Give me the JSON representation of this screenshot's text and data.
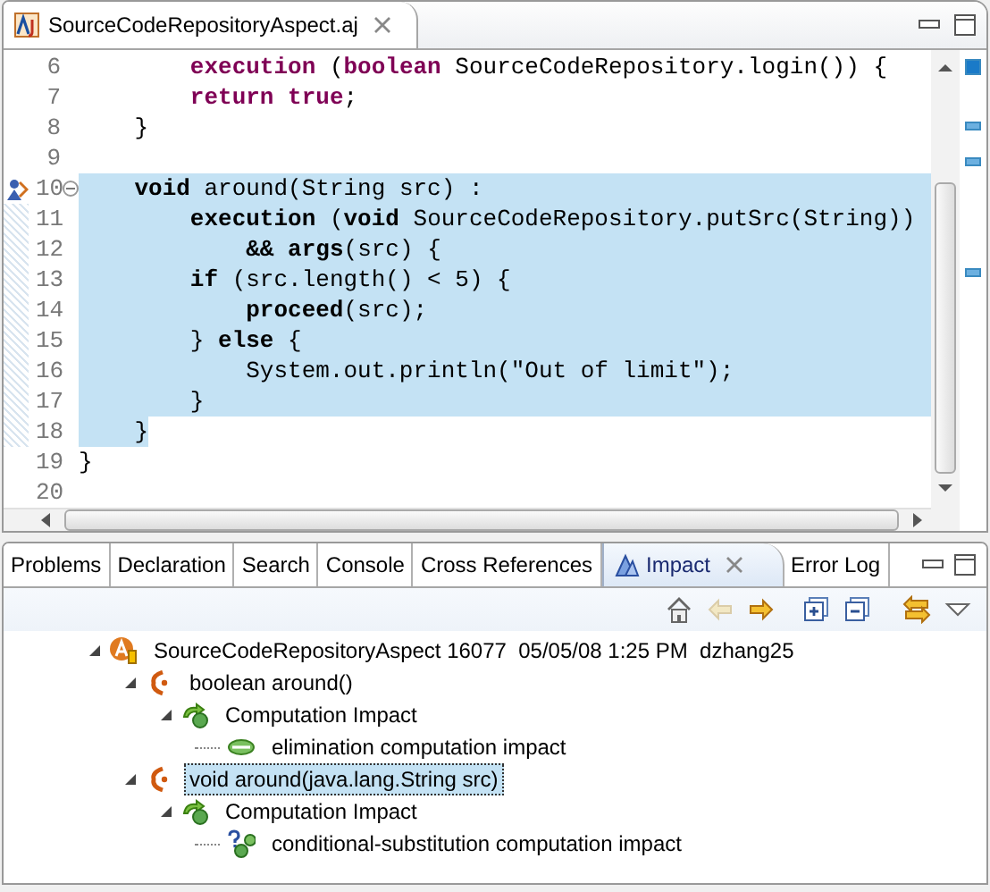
{
  "editor": {
    "tab": {
      "title": "SourceCodeRepositoryAspect.aj"
    },
    "lines": [
      {
        "number": "6",
        "code": "        **execution** (**boolean** SourceCodeRepository.login()) {",
        "selected": false
      },
      {
        "number": "7",
        "code": "        **return** **true**;",
        "selected": false
      },
      {
        "number": "8",
        "code": "    }",
        "selected": false
      },
      {
        "number": "9",
        "selected": false
      },
      {
        "number": "10",
        "code": "    **void** around(String src) :",
        "selected": true,
        "annotation": true,
        "folded": false
      },
      {
        "number": "11",
        "code": "        **execution** (**void** SourceCodeRepository.putSrc(String))",
        "selected": true
      },
      {
        "number": "12",
        "code": "            **&&** **args**(src) {",
        "selected": true
      },
      {
        "number": "13",
        "code": "        **if** (src.length() < 5) {",
        "selected": true
      },
      {
        "number": "14",
        "code": "            **proceed**(src);",
        "selected": true
      },
      {
        "number": "15",
        "code": "        } **else** {",
        "selected": true
      },
      {
        "number": "16",
        "code": "            System.out.println(\"Out of limit\");",
        "selected": true
      },
      {
        "number": "17",
        "code": "        }",
        "selected": true
      },
      {
        "number": "18",
        "code": "    }",
        "selected": true
      },
      {
        "number": "19",
        "code": "}",
        "selected": false
      },
      {
        "number": "20",
        "selected": false
      }
    ]
  },
  "views": {
    "tabs": [
      {
        "label": "Problems",
        "selected": false
      },
      {
        "label": "Declaration",
        "selected": false
      },
      {
        "label": "Search",
        "selected": false
      },
      {
        "label": "Console",
        "selected": false
      },
      {
        "label": "Cross References",
        "selected": false
      },
      {
        "label": "Impact",
        "selected": true
      },
      {
        "label": "Error Log",
        "selected": false
      }
    ],
    "toolbar": [
      {
        "kind": "home",
        "disabled": false
      },
      {
        "kind": "back",
        "disabled": true
      },
      {
        "kind": "forward",
        "disabled": false
      },
      {
        "kind": "expand-all",
        "disabled": false
      },
      {
        "kind": "collapse-all",
        "disabled": false
      },
      {
        "kind": "sync",
        "disabled": false
      },
      {
        "kind": "menu",
        "disabled": false
      }
    ],
    "impact_tree": [
      {
        "label": "SourceCodeRepositoryAspect 16077  05/05/08 1:25 PM  dzhang25",
        "kind": "aspect",
        "expanded": true,
        "selected": false,
        "children": [
          {
            "label": "boolean around()",
            "kind": "advice",
            "expanded": true,
            "selected": false,
            "children": [
              {
                "label": "Computation Impact",
                "kind": "impact-group",
                "expanded": true,
                "selected": false,
                "children": [
                  {
                    "label": "elimination computation impact",
                    "kind": "elimination",
                    "selected": false
                  }
                ]
              }
            ]
          },
          {
            "label": "void around(java.lang.String src)",
            "kind": "advice",
            "expanded": true,
            "selected": true,
            "children": [
              {
                "label": "Computation Impact",
                "kind": "impact-group",
                "expanded": true,
                "selected": false,
                "children": [
                  {
                    "label": "conditional-substitution computation impact",
                    "kind": "conditional",
                    "selected": false
                  }
                ]
              }
            ]
          }
        ]
      }
    ]
  }
}
